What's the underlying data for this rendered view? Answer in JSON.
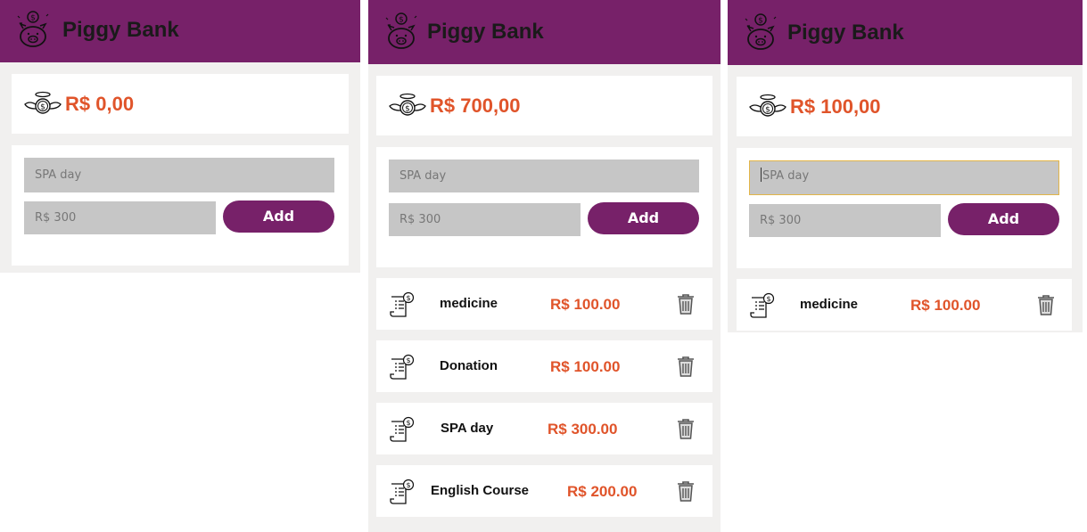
{
  "panels": [
    {
      "title": "Piggy Bank",
      "balance": "R$ 0,00",
      "description_placeholder": "SPA day",
      "value_placeholder": "R$ 300",
      "add_label": "Add",
      "items": []
    },
    {
      "title": "Piggy Bank",
      "balance": "R$ 700,00",
      "description_placeholder": "SPA day",
      "value_placeholder": "R$ 300",
      "add_label": "Add",
      "items": [
        {
          "name": "medicine",
          "amount": "R$ 100.00"
        },
        {
          "name": "Donation",
          "amount": "R$ 100.00"
        },
        {
          "name": "SPA day",
          "amount": "R$ 300.00"
        },
        {
          "name": "English Course",
          "amount": "R$ 200.00"
        }
      ]
    },
    {
      "title": "Piggy Bank",
      "balance": "R$ 100,00",
      "description_placeholder": "SPA day",
      "value_placeholder": "R$ 300",
      "add_label": "Add",
      "items": [
        {
          "name": "medicine",
          "amount": "R$ 100.00"
        }
      ]
    }
  ],
  "icons": {
    "logo": "piggy-bank-icon",
    "balance": "angel-coin-icon",
    "item": "receipt-icon",
    "delete": "trash-icon"
  },
  "colors": {
    "brand": "#772169",
    "amount": "#e0542a"
  }
}
